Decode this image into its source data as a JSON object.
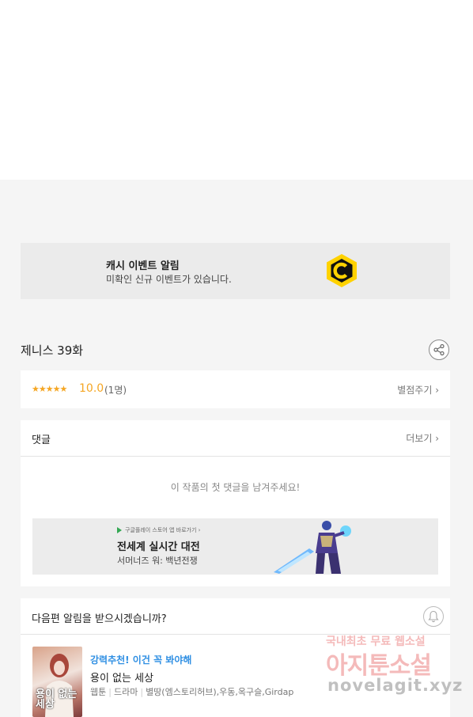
{
  "event_banner": {
    "title": "캐시 이벤트 알림",
    "subtitle": "미확인 신규 이벤트가 있습니다.",
    "icon": "coin-c-icon",
    "icon_color": "#ffd200"
  },
  "episode": {
    "title": "제니스 39화"
  },
  "rating": {
    "stars": "★★★★★",
    "value": "10.0",
    "count": "(1명)",
    "rate_label": "별점주기 ›"
  },
  "comments": {
    "header": "댓글",
    "more_label": "더보기 ›",
    "empty_message": "이 작품의 첫 댓글을 남겨주세요!"
  },
  "ad": {
    "store_text": "구글플레이 스토어 앱 바로가기 ›",
    "title": "전세계 실시간 대전",
    "subtitle": "서머너즈 워: 백년전쟁"
  },
  "notify": {
    "question": "다음편 알림을 받으시겠습니까?",
    "recommendation": {
      "cover_text": "용이 없는 세상",
      "tag": "강력추천! 이건 꼭 봐야해",
      "title": "용이 없는 세상",
      "meta": [
        "웹툰",
        "드라마",
        "별땅(엠스토리허브),우동,옥구슬,Girdap"
      ]
    }
  },
  "watermark": {
    "line1": "국내최초 무료 웹소설",
    "line2": "아지툰소설",
    "line3": "novelagit.xyz"
  },
  "colors": {
    "accent_star": "#f5a623",
    "link_blue": "#2f8fe3"
  }
}
